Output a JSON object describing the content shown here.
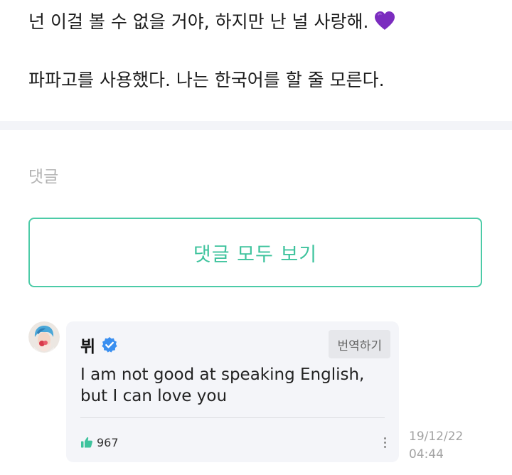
{
  "post": {
    "line1": "넌 이걸 볼 수 없을 거야, 하지만 난 널 사랑해.",
    "line1_emoji": "purple-heart-emoji",
    "line2": "파파고를 사용했다. 나는 한국어를 할 줄 모른다."
  },
  "comments_section": {
    "label": "댓글",
    "view_all_label": "댓글 모두 보기"
  },
  "comment": {
    "author": "뷔",
    "verified_icon": "verified-badge-icon",
    "translate_label": "번역하기",
    "text": "I am not good at speaking English, but I can love you",
    "like_icon": "thumbs-up-icon",
    "like_count": "967",
    "more_icon": "more-vertical-icon",
    "date": "19/12/22",
    "time": "04:44"
  },
  "colors": {
    "accent": "#3ec39d",
    "verified": "#3a8ff0",
    "heart": "#7b2cbf",
    "card_bg": "#f4f5f9"
  }
}
